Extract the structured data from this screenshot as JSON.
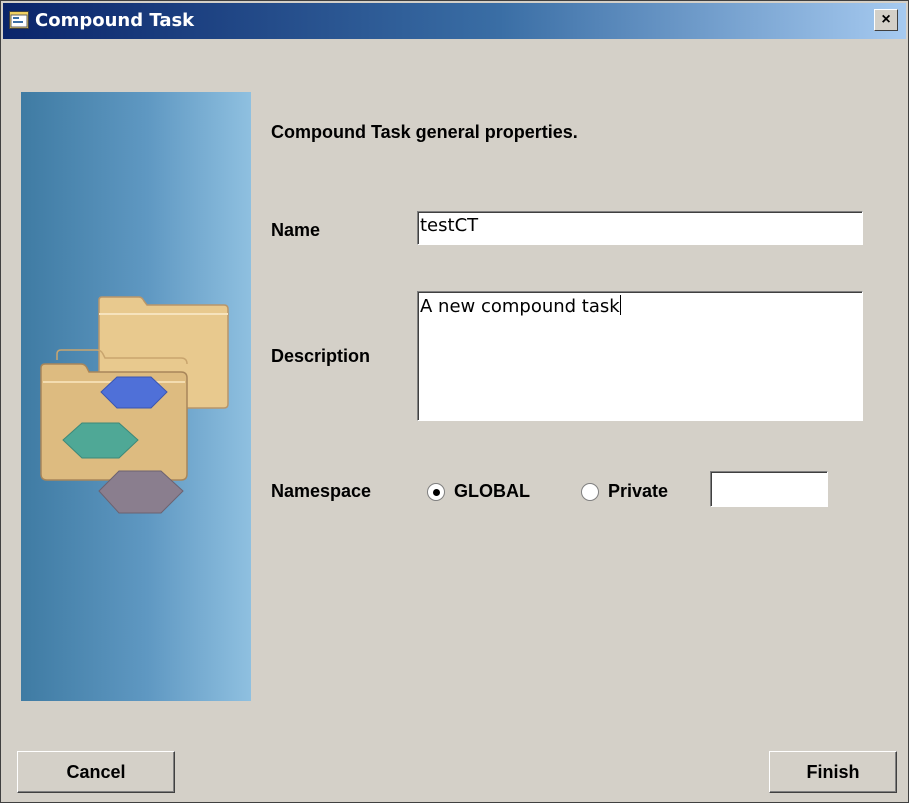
{
  "window": {
    "title": "Compound Task",
    "close_glyph": "×",
    "icon": "dialog-app-icon"
  },
  "panel": {
    "art": "folders-and-hexagons-illustration"
  },
  "form": {
    "heading": "Compound Task general properties.",
    "name_label": "Name",
    "name_value": "testCT",
    "description_label": "Description",
    "description_value": "A new compound task",
    "namespace_label": "Namespace",
    "namespace_options": [
      {
        "label": "GLOBAL",
        "selected": true
      },
      {
        "label": "Private",
        "selected": false
      }
    ],
    "private_value": ""
  },
  "buttons": {
    "cancel": "Cancel",
    "finish": "Finish"
  }
}
